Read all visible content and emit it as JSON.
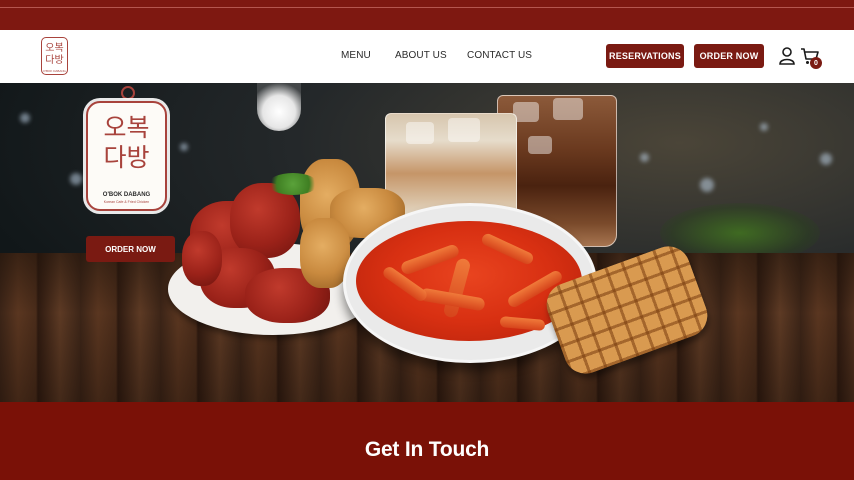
{
  "brand": {
    "logo_korean_line1": "오복",
    "logo_korean_line2": "다방",
    "logo_name": "O'BOK DABANG",
    "logo_tagline": "Korean Cafe & Fried Chicken"
  },
  "nav": {
    "links": [
      {
        "label": "MENU"
      },
      {
        "label": "ABOUT US"
      },
      {
        "label": "CONTACT US"
      }
    ],
    "reservations_label": "RESERVATIONS",
    "order_now_label": "ORDER NOW",
    "cart_count": "0"
  },
  "hero": {
    "order_now_label": "ORDER NOW"
  },
  "footer": {
    "heading": "Get In Touch"
  },
  "colors": {
    "brand_red": "#7a1a12",
    "top_bar": "#7e1811",
    "footer_band": "#7a1107"
  },
  "icons": [
    "user-icon",
    "cart-icon"
  ]
}
